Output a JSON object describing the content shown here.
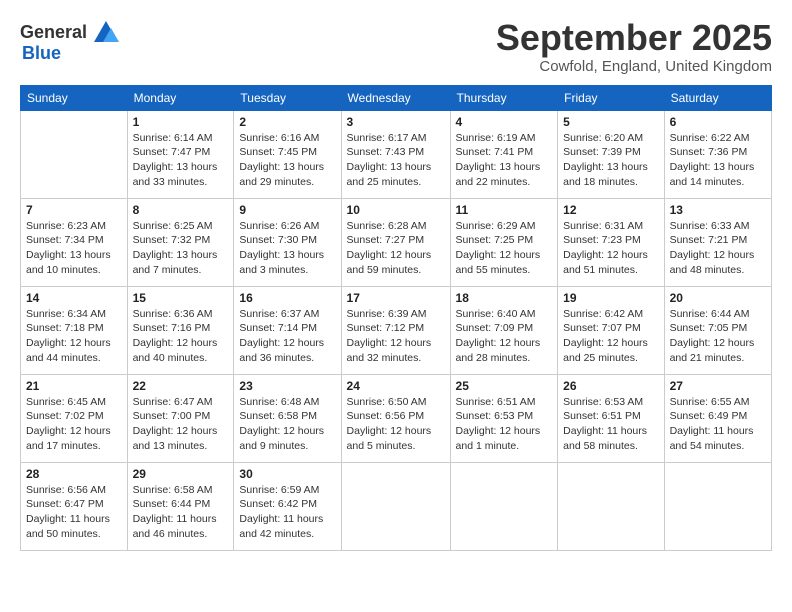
{
  "logo": {
    "general": "General",
    "blue": "Blue"
  },
  "header": {
    "month": "September 2025",
    "location": "Cowfold, England, United Kingdom"
  },
  "weekdays": [
    "Sunday",
    "Monday",
    "Tuesday",
    "Wednesday",
    "Thursday",
    "Friday",
    "Saturday"
  ],
  "weeks": [
    [
      {
        "day": "",
        "info": ""
      },
      {
        "day": "1",
        "info": "Sunrise: 6:14 AM\nSunset: 7:47 PM\nDaylight: 13 hours\nand 33 minutes."
      },
      {
        "day": "2",
        "info": "Sunrise: 6:16 AM\nSunset: 7:45 PM\nDaylight: 13 hours\nand 29 minutes."
      },
      {
        "day": "3",
        "info": "Sunrise: 6:17 AM\nSunset: 7:43 PM\nDaylight: 13 hours\nand 25 minutes."
      },
      {
        "day": "4",
        "info": "Sunrise: 6:19 AM\nSunset: 7:41 PM\nDaylight: 13 hours\nand 22 minutes."
      },
      {
        "day": "5",
        "info": "Sunrise: 6:20 AM\nSunset: 7:39 PM\nDaylight: 13 hours\nand 18 minutes."
      },
      {
        "day": "6",
        "info": "Sunrise: 6:22 AM\nSunset: 7:36 PM\nDaylight: 13 hours\nand 14 minutes."
      }
    ],
    [
      {
        "day": "7",
        "info": "Sunrise: 6:23 AM\nSunset: 7:34 PM\nDaylight: 13 hours\nand 10 minutes."
      },
      {
        "day": "8",
        "info": "Sunrise: 6:25 AM\nSunset: 7:32 PM\nDaylight: 13 hours\nand 7 minutes."
      },
      {
        "day": "9",
        "info": "Sunrise: 6:26 AM\nSunset: 7:30 PM\nDaylight: 13 hours\nand 3 minutes."
      },
      {
        "day": "10",
        "info": "Sunrise: 6:28 AM\nSunset: 7:27 PM\nDaylight: 12 hours\nand 59 minutes."
      },
      {
        "day": "11",
        "info": "Sunrise: 6:29 AM\nSunset: 7:25 PM\nDaylight: 12 hours\nand 55 minutes."
      },
      {
        "day": "12",
        "info": "Sunrise: 6:31 AM\nSunset: 7:23 PM\nDaylight: 12 hours\nand 51 minutes."
      },
      {
        "day": "13",
        "info": "Sunrise: 6:33 AM\nSunset: 7:21 PM\nDaylight: 12 hours\nand 48 minutes."
      }
    ],
    [
      {
        "day": "14",
        "info": "Sunrise: 6:34 AM\nSunset: 7:18 PM\nDaylight: 12 hours\nand 44 minutes."
      },
      {
        "day": "15",
        "info": "Sunrise: 6:36 AM\nSunset: 7:16 PM\nDaylight: 12 hours\nand 40 minutes."
      },
      {
        "day": "16",
        "info": "Sunrise: 6:37 AM\nSunset: 7:14 PM\nDaylight: 12 hours\nand 36 minutes."
      },
      {
        "day": "17",
        "info": "Sunrise: 6:39 AM\nSunset: 7:12 PM\nDaylight: 12 hours\nand 32 minutes."
      },
      {
        "day": "18",
        "info": "Sunrise: 6:40 AM\nSunset: 7:09 PM\nDaylight: 12 hours\nand 28 minutes."
      },
      {
        "day": "19",
        "info": "Sunrise: 6:42 AM\nSunset: 7:07 PM\nDaylight: 12 hours\nand 25 minutes."
      },
      {
        "day": "20",
        "info": "Sunrise: 6:44 AM\nSunset: 7:05 PM\nDaylight: 12 hours\nand 21 minutes."
      }
    ],
    [
      {
        "day": "21",
        "info": "Sunrise: 6:45 AM\nSunset: 7:02 PM\nDaylight: 12 hours\nand 17 minutes."
      },
      {
        "day": "22",
        "info": "Sunrise: 6:47 AM\nSunset: 7:00 PM\nDaylight: 12 hours\nand 13 minutes."
      },
      {
        "day": "23",
        "info": "Sunrise: 6:48 AM\nSunset: 6:58 PM\nDaylight: 12 hours\nand 9 minutes."
      },
      {
        "day": "24",
        "info": "Sunrise: 6:50 AM\nSunset: 6:56 PM\nDaylight: 12 hours\nand 5 minutes."
      },
      {
        "day": "25",
        "info": "Sunrise: 6:51 AM\nSunset: 6:53 PM\nDaylight: 12 hours\nand 1 minute."
      },
      {
        "day": "26",
        "info": "Sunrise: 6:53 AM\nSunset: 6:51 PM\nDaylight: 11 hours\nand 58 minutes."
      },
      {
        "day": "27",
        "info": "Sunrise: 6:55 AM\nSunset: 6:49 PM\nDaylight: 11 hours\nand 54 minutes."
      }
    ],
    [
      {
        "day": "28",
        "info": "Sunrise: 6:56 AM\nSunset: 6:47 PM\nDaylight: 11 hours\nand 50 minutes."
      },
      {
        "day": "29",
        "info": "Sunrise: 6:58 AM\nSunset: 6:44 PM\nDaylight: 11 hours\nand 46 minutes."
      },
      {
        "day": "30",
        "info": "Sunrise: 6:59 AM\nSunset: 6:42 PM\nDaylight: 11 hours\nand 42 minutes."
      },
      {
        "day": "",
        "info": ""
      },
      {
        "day": "",
        "info": ""
      },
      {
        "day": "",
        "info": ""
      },
      {
        "day": "",
        "info": ""
      }
    ]
  ]
}
